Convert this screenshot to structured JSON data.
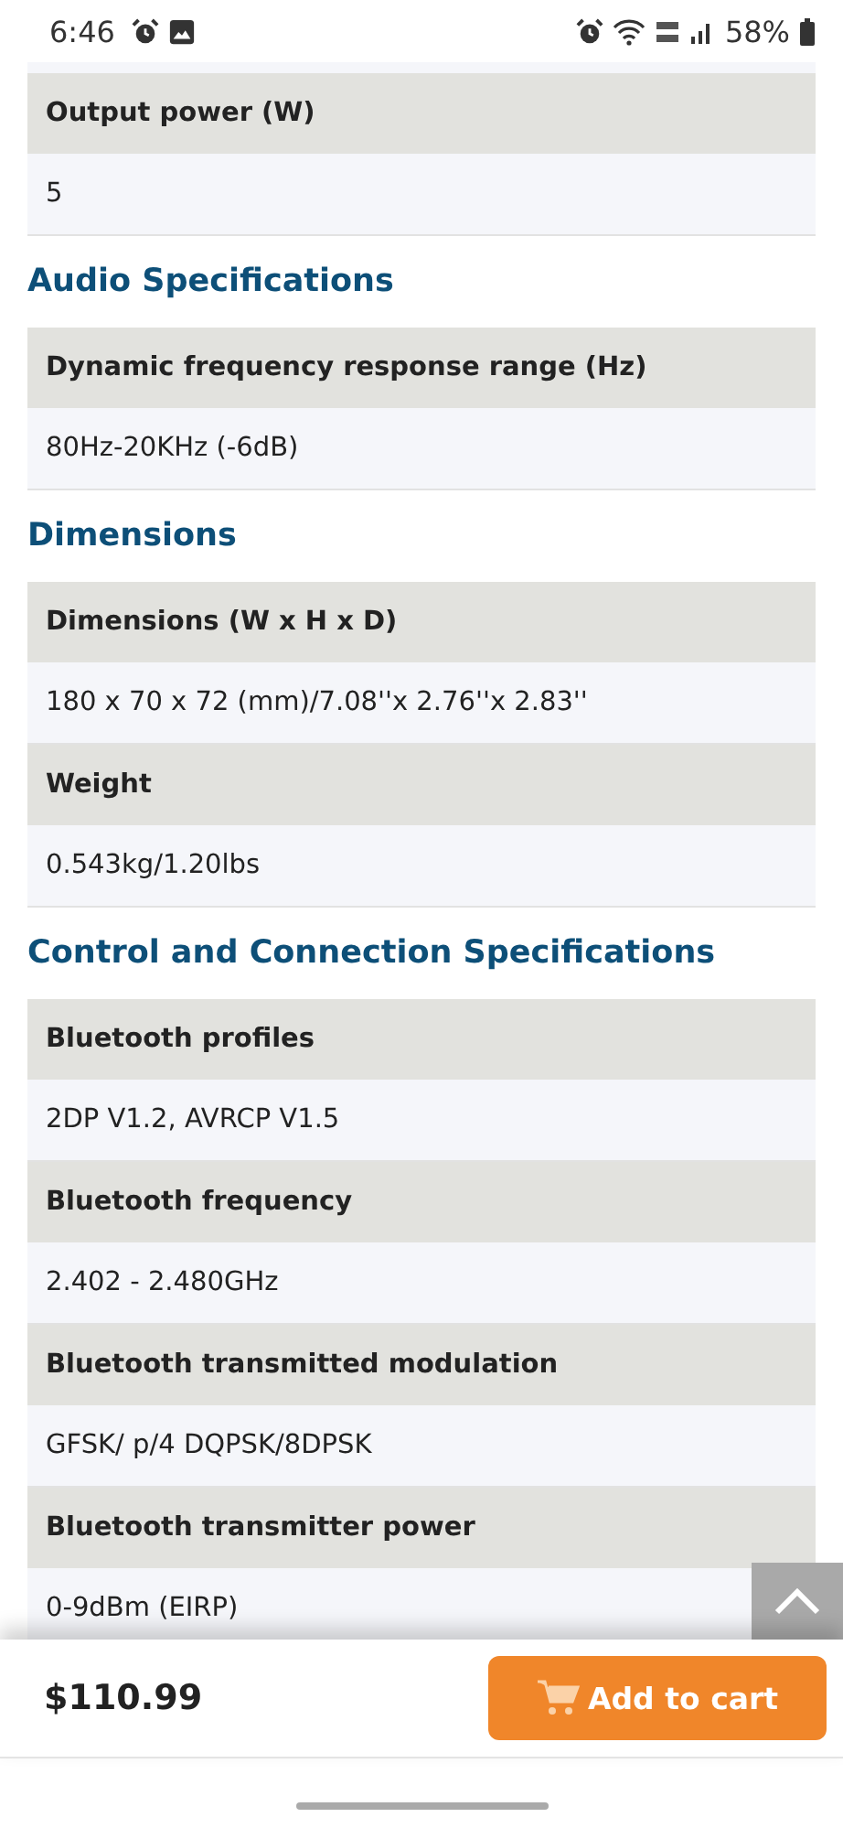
{
  "status_bar": {
    "time": "6:46",
    "battery": "58%"
  },
  "sections": [
    {
      "specs": [
        {
          "label": "Output power (W)",
          "value": "5"
        }
      ]
    },
    {
      "title": "Audio Specifications",
      "specs": [
        {
          "label": "Dynamic frequency response range (Hz)",
          "value": "80Hz-20KHz (-6dB)"
        }
      ]
    },
    {
      "title": "Dimensions",
      "specs": [
        {
          "label": "Dimensions (W x H x D)",
          "value": "180 x 70 x 72 (mm)/7.08''x 2.76''x 2.83''"
        },
        {
          "label": "Weight",
          "value": "0.543kg/1.20lbs"
        }
      ]
    },
    {
      "title": "Control and Connection Specifications",
      "specs": [
        {
          "label": "Bluetooth profiles",
          "value": "2DP V1.2, AVRCP V1.5"
        },
        {
          "label": "Bluetooth frequency",
          "value": "2.402 - 2.480GHz"
        },
        {
          "label": "Bluetooth transmitted modulation",
          "value": "GFSK/ p/4 DQPSK/8DPSK"
        },
        {
          "label": "Bluetooth transmitter power",
          "value": "0-9dBm (EIRP)"
        }
      ]
    }
  ],
  "bottom_bar": {
    "price": "$110.99",
    "button": "Add to cart"
  }
}
